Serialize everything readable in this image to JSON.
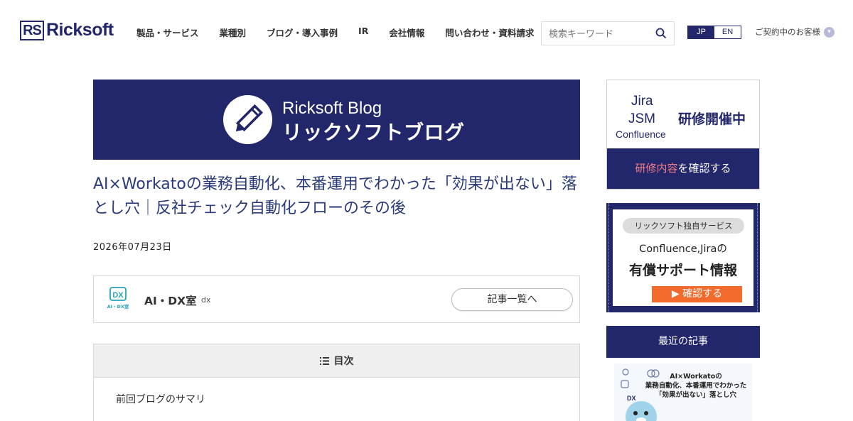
{
  "header": {
    "logo_mark": "RS",
    "logo_text": "Ricksoft",
    "nav": [
      {
        "label": "製品・サービス"
      },
      {
        "label": "業種別"
      },
      {
        "label": "ブログ・導入事例"
      },
      {
        "label": "IR"
      },
      {
        "label": "会社情報"
      },
      {
        "label": "問い合わせ・資料請求"
      }
    ],
    "search_placeholder": "検索キーワード",
    "lang_jp": "JP",
    "lang_en": "EN",
    "customer_label": "ご契約中のお客様"
  },
  "banner": {
    "line1": "Ricksoft Blog",
    "line2": "リックソフトブログ"
  },
  "article": {
    "title": "AI×Workatoの業務自動化、本番運用でわかった「効果が出ない」落とし穴｜反社チェック自動化フローのその後",
    "date": "2026年07月23日"
  },
  "author": {
    "avatar_text_top": "DX",
    "avatar_text_bottom": "AI・DX室",
    "name": "AI・DX室",
    "id": "dx",
    "list_button": "記事一覧へ"
  },
  "toc": {
    "heading": "目次",
    "items": [
      {
        "label": "前回ブログのサマリ"
      }
    ]
  },
  "sidebar": {
    "ad1": {
      "product1": "Jira",
      "product2": "JSM",
      "product3": "Confluence",
      "headline": "研修開催中",
      "cta_highlight": "研修内容",
      "cta_rest": "を確認する"
    },
    "ad2": {
      "pill": "リックソフト独自サービス",
      "line1": "Confluence,Jiraの",
      "line2_bold": "有償サポート",
      "line2_rest": "情報",
      "button": "▶ 確認する"
    },
    "recent": {
      "heading": "最近の記事",
      "thumb_line1": "AI×Workatoの",
      "thumb_line2": "業務自動化、本番運用でわかった",
      "thumb_line3": "「効果が出ない」落とし穴",
      "thumb_badge": "DX"
    }
  },
  "colors": {
    "brand_navy": "#22266a",
    "title_blue": "#2a3a7a",
    "accent_orange": "#f36b2c",
    "accent_pink": "#f47d88"
  }
}
